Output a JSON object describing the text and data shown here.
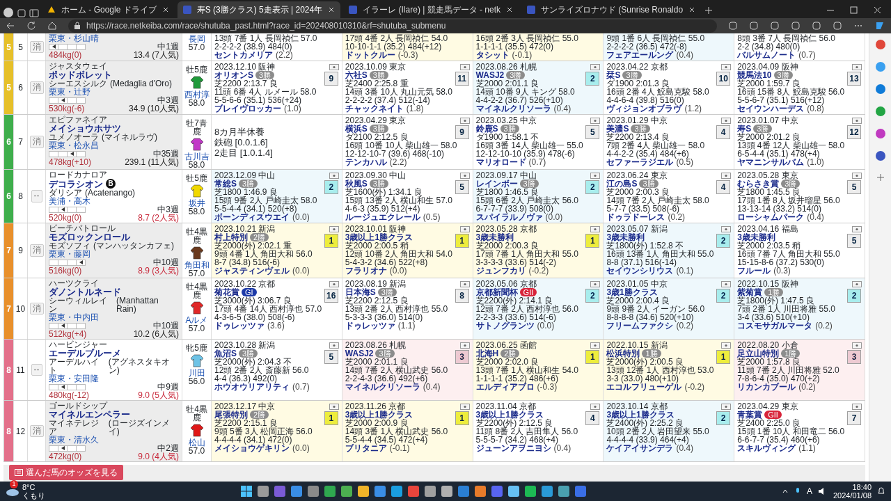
{
  "browser": {
    "tabs": [
      {
        "title": "ホーム - Google ドライブ",
        "selected": false
      },
      {
        "title": "寿S (3勝クラス) 5走表示 | 2024年",
        "selected": true
      },
      {
        "title": "イラーレ (Ilare) | 競走馬データ - netk",
        "selected": false
      },
      {
        "title": "サンライズロナウド (Sunrise Ronaldo",
        "selected": false
      }
    ],
    "url": "https://race.netkeiba.com/race/shutuba_past.html?race_id=202408010310&rf=shutuba_submenu"
  },
  "race_table": {
    "rows": [
      {
        "frame": "5",
        "color": "#e6c02a",
        "number": "5",
        "eliminated": true,
        "scratch_label": "消",
        "horse": {
          "trainer": "栗東・杉山晴",
          "marks": [
            {
              "selected": true
            },
            {
              "selected": false
            },
            {
              "selected": false
            },
            {
              "selected": false
            }
          ],
          "rotation": "中1週",
          "weight": "484kg(0)",
          "odds": "13.4 (7人気)",
          "odds_hot": false
        },
        "jockey": {
          "name": "長岡",
          "weight": "57.0"
        },
        "races": [
          {
            "kind": "race",
            "color": "#ffffff",
            "field": "13頭 7番 1人 長岡禎仁 57.0",
            "passing": "2-2-2-2 (38.9) 484(0)",
            "winner": "セントカメリア",
            "margin": "(2.2)"
          },
          {
            "kind": "race",
            "color": "#fffbe3",
            "field": "17頭 4番 2人 長岡禎仁 54.0",
            "passing": "10-10-1-1 (35.2) 484(+12)",
            "winner": "ドットクルー",
            "margin": "(-0.3)"
          },
          {
            "kind": "race",
            "color": "#fffbe3",
            "field": "16頭 2番 3人 長岡禎仁 55.0",
            "passing": "1-1-1-1 (35.5) 472(0)",
            "winner": "タシット",
            "margin": "(-0.1)"
          },
          {
            "kind": "race",
            "color": "#eef8fc",
            "field": "9頭 1番 6人 長岡禎仁 55.0",
            "passing": "2-2-2-2 (36.5) 472(-8)",
            "winner": "フェアエールング",
            "margin": "(0.4)"
          },
          {
            "kind": "race",
            "color": "#ffffff",
            "field": "8頭 3番 7人 長岡禎仁 56.0",
            "passing": "2-2 (34.8) 480(0)",
            "winner": "バルサムノート",
            "margin": "(0.7)"
          }
        ]
      },
      {
        "frame": "5",
        "color": "#e6c02a",
        "number": "6",
        "eliminated": true,
        "scratch_label": "消",
        "horse": {
          "sire": "ジャスタウェイ",
          "name": "ポッドボレット",
          "sex_age": "牡5鹿",
          "dam": "シーエスシルク",
          "damsire": "(Medaglia d'Oro)",
          "trainer": "栗東・辻野",
          "marks": [
            {
              "selected": false
            },
            {
              "selected": true
            },
            {
              "selected": false
            },
            {
              "selected": false
            }
          ],
          "rotation": "中3週",
          "weight": "530kg(-6)",
          "odds": "34.9 (10人気)",
          "odds_hot": false
        },
        "jockey": {
          "color": "#1f9a3a",
          "name": "西村淳",
          "weight": "58.0"
        },
        "races": [
          {
            "kind": "race",
            "color": "#ffffff",
            "date": "2023.12.10 阪神",
            "name": "オリオンS",
            "badge": {
              "text": "3勝",
              "color": "#8c8c8c"
            },
            "finish": "9",
            "course": "芝2200 2:13.7 良",
            "field": "11頭 6番 4人 ルメール 58.0",
            "passing": "5-5-6-6 (35.1) 536(+24)",
            "winner": "ブレイヴロッカー",
            "margin": "(1.0)"
          },
          {
            "kind": "race",
            "color": "#ffffff",
            "date": "2023.10.09 東京",
            "name": "六社S",
            "badge": {
              "text": "3勝",
              "color": "#8c8c8c"
            },
            "finish": "11",
            "course": "芝2400 2:25.8 重",
            "field": "14頭 3番 10人 丸山元気 58.0",
            "passing": "2-2-2-2 (37.4) 512(-14)",
            "winner": "チャックネイト",
            "margin": "(1.8)"
          },
          {
            "kind": "race",
            "color": "#eef8fc",
            "date": "2023.08.26 札幌",
            "name": "WASJ2",
            "badge": {
              "text": "3勝",
              "color": "#8c8c8c"
            },
            "finish": "2",
            "course": "芝2000 2:01.1 良",
            "field": "14頭 10番 9人 キング 58.0",
            "passing": "4-4-2-2 (36.7) 526(+10)",
            "winner": "マイネルクリソーラ",
            "margin": "(0.4)"
          },
          {
            "kind": "race",
            "color": "#ffffff",
            "date": "2023.04.22 京都",
            "name": "栞S",
            "badge": {
              "text": "3勝",
              "color": "#8c8c8c"
            },
            "finish": "10",
            "course": "ダ1900 2:01.3 良",
            "field": "16頭 2番 4人 鮫島克駿 58.0",
            "passing": "4-4-6-4 (39.8) 516(0)",
            "winner": "ヴィジョンオブラヴ",
            "margin": "(1.2)"
          },
          {
            "kind": "race",
            "color": "#ffffff",
            "date": "2023.04.09 阪神",
            "name": "競馬法10",
            "badge": {
              "text": "3勝",
              "color": "#8c8c8c"
            },
            "finish": "13",
            "course": "芝2000 1:59.7 良",
            "field": "16頭 15番 8人 鮫島克駿 56.0",
            "passing": "5-5-6-7 (35.1) 516(+12)",
            "winner": "セイウンハーデス",
            "margin": "(0.8)"
          }
        ]
      },
      {
        "frame": "6",
        "color": "#3fae4c",
        "number": "7",
        "eliminated": true,
        "scratch_label": "消",
        "horse": {
          "sire": "エピファネイア",
          "name": "メイショウホサツ",
          "sex_age": "牡7青鹿",
          "dam": "ユメノオーラ",
          "damsire": "(マイネルラヴ)",
          "trainer": "栗東・松永昌",
          "marks": [
            {
              "selected": false
            },
            {
              "selected": false
            },
            {
              "selected": true
            },
            {
              "selected": false
            }
          ],
          "rotation": "中35週",
          "weight": "478kg(+10)",
          "odds": "239.1 (11人気)",
          "odds_hot": false
        },
        "jockey": {
          "color": "#c238c8",
          "name": "古川吉",
          "weight": "58.0"
        },
        "races": [
          {
            "kind": "layoff",
            "lines": [
              "8カ月半休養",
              "鉄砲 [0.0.1.6]",
              "2走目 [1.0.1.4]"
            ]
          },
          {
            "kind": "race",
            "color": "#ffffff",
            "date": "2023.04.29 東京",
            "name": "横浜S",
            "badge": {
              "text": "3勝",
              "color": "#8c8c8c"
            },
            "finish": "9",
            "course": "ダ2100 2:12.5 良",
            "field": "16頭 10番 10人 柴山雄一 58.0",
            "passing": "12-12-10-7 (39.6) 468(-10)",
            "winner": "テンカハル",
            "margin": "(2.2)"
          },
          {
            "kind": "race",
            "color": "#ffffff",
            "date": "2023.03.25 中京",
            "name": "鈴鹿S",
            "badge": {
              "text": "3勝",
              "color": "#8c8c8c"
            },
            "finish": "5",
            "course": "ダ1900 1:58.1 不",
            "field": "16頭 3番 14人 柴山雄一 55.0",
            "passing": "12-12-10-10 (35.9) 478(-6)",
            "winner": "マリオロード",
            "margin": "(0.7)"
          },
          {
            "kind": "race",
            "color": "#ffffff",
            "date": "2023.01.29 中京",
            "name": "美濃S",
            "badge": {
              "text": "3勝",
              "color": "#8c8c8c"
            },
            "finish": "4",
            "course": "芝2200 2:13.4 良",
            "field": "7頭 2番 4人 柴山雄一 58.0",
            "passing": "4-4-2-2 (35.4) 484(+6)",
            "winner": "セファーラジエル",
            "margin": "(0.5)"
          },
          {
            "kind": "race",
            "color": "#ffffff",
            "date": "2023.01.07 中京",
            "name": "寿S",
            "badge": {
              "text": "3勝",
              "color": "#8c8c8c"
            },
            "finish": "12",
            "course": "芝2000 2:01.2 良",
            "field": "13頭 4番 12人 柴山雄一 58.0",
            "passing": "6-5-4-4 (35.1) 478(+4)",
            "winner": "ヤマニンサルバム",
            "margin": "(1.0)"
          }
        ]
      },
      {
        "frame": "6",
        "color": "#3fae4c",
        "number": "8",
        "eliminated": false,
        "scratch_label": "--",
        "horse": {
          "sire": "ロードカナロア",
          "name": "デコラシオン",
          "blinker": "B",
          "sex_age": "牡5鹿",
          "dam": "ダリシア",
          "damsire": "(Acatenango)",
          "trainer": "美浦・高木",
          "marks": [
            {
              "selected": false
            },
            {
              "selected": true
            },
            {
              "selected": false
            },
            {
              "selected": false
            }
          ],
          "rotation": "中3週",
          "weight": "520kg(0)",
          "odds": "8.7 (2人気)",
          "odds_hot": true
        },
        "jockey": {
          "color": "#f0d800",
          "name": "坂井",
          "weight": "58.0"
        },
        "races": [
          {
            "kind": "race",
            "color": "#eef8fc",
            "date": "2023.12.09 中山",
            "name": "常総S",
            "badge": {
              "text": "3勝",
              "color": "#8c8c8c"
            },
            "finish": "2",
            "course": "芝1800 1:46.9 良",
            "field": "15頭 9番 2人 戸崎圭太 58.0",
            "passing": "5-5-4-4 (34.1) 520(+8)",
            "winner": "ボーンディスウエイ",
            "margin": "(0.0)"
          },
          {
            "kind": "race",
            "color": "#ffffff",
            "date": "2023.09.30 中山",
            "name": "秋風S",
            "badge": {
              "text": "3勝",
              "color": "#8c8c8c"
            },
            "finish": "5",
            "course": "芝1600(外) 1:34.1 良",
            "field": "15頭 13番 2人 横山和生 57.0",
            "passing": "4-6-3 (35.9) 512(+4)",
            "winner": "ルージュエクレール",
            "margin": "(0.5)"
          },
          {
            "kind": "race",
            "color": "#eef8fc",
            "date": "2023.09.17 中山",
            "name": "レインボー",
            "badge": {
              "text": "3勝",
              "color": "#8c8c8c"
            },
            "finish": "2",
            "course": "芝1800 1:46.5 良",
            "field": "15頭 6番 2人 戸崎圭太 56.0",
            "passing": "6-7-7-7 (33.9) 508(0)",
            "winner": "スパイラルノヴァ",
            "margin": "(0.0)"
          },
          {
            "kind": "race",
            "color": "#ffffff",
            "date": "2023.06.24 東京",
            "name": "江の島S",
            "badge": {
              "text": "3勝",
              "color": "#8c8c8c"
            },
            "finish": "4",
            "course": "芝2000 2:00.3 良",
            "field": "14頭 7番 2人 戸崎圭太 58.0",
            "passing": "5-7-7 (33.5) 508(-6)",
            "winner": "ドゥラドーレス",
            "margin": "(0.2)"
          },
          {
            "kind": "race",
            "color": "#ffffff",
            "date": "2023.05.28 東京",
            "name": "むらさき賞",
            "badge": {
              "text": "3勝",
              "color": "#8c8c8c"
            },
            "finish": "5",
            "course": "芝1800 1:45.5 良",
            "field": "17頭 1番 8人 坂井瑠星 56.0",
            "passing": "13-13-14 (33.2) 514(0)",
            "winner": "ローシャムパーク",
            "margin": "(0.4)"
          }
        ]
      },
      {
        "frame": "7",
        "color": "#e8902c",
        "number": "9",
        "eliminated": true,
        "scratch_label": "消",
        "horse": {
          "sire": "ビーチパトロール",
          "name": "モズロックンロール",
          "sex_age": "牡4黒鹿",
          "dam": "モズソフィ",
          "damsire": "(マンハッタンカフェ)",
          "trainer": "栗東・藤岡",
          "marks": [
            {
              "selected": false
            },
            {
              "selected": false
            },
            {
              "selected": false
            },
            {
              "selected": true
            }
          ],
          "rotation": "中10週",
          "weight": "516kg(0)",
          "odds": "8.9 (3人気)",
          "odds_hot": true
        },
        "jockey": {
          "color": "#6b3a1e",
          "name": "角田和",
          "weight": "57.0"
        },
        "races": [
          {
            "kind": "race",
            "color": "#fffbe3",
            "date": "2023.10.21 新潟",
            "name": "村上特別",
            "badge": {
              "text": "2勝",
              "color": "#8c8c8c"
            },
            "finish": "1",
            "course": "芝2000(外) 2:02.1 重",
            "field": "9頭 4番 1人 角田大和 56.0",
            "passing": "8-7 (34.8) 516(-6)",
            "winner": "ジャスティンヴェル",
            "margin": "(0.0)"
          },
          {
            "kind": "race",
            "color": "#fffbe3",
            "date": "2023.10.01 阪神",
            "name": "3歳以上1勝クラス",
            "finish": "1",
            "course": "芝2000 2:00.5 稍",
            "field": "12頭 10番 2人 角田大和 54.0",
            "passing": "5-4-3-2 (34.6) 522(+8)",
            "winner": "フラリオナ",
            "margin": "(0.0)"
          },
          {
            "kind": "race",
            "color": "#fffbe3",
            "date": "2023.05.28 京都",
            "name": "3歳未勝利",
            "finish": "1",
            "course": "芝2000 2:00.3 良",
            "field": "17頭 7番 1人 角田大和 55.0",
            "passing": "3-3-3-3 (33.6) 514(-2)",
            "winner": "ジュンフカリ",
            "margin": "(-0.2)"
          },
          {
            "kind": "race",
            "color": "#eef8fc",
            "date": "2023.05.07 新潟",
            "name": "3歳未勝利",
            "finish": "2",
            "course": "芝1800(外) 1:52.8 不",
            "field": "16頭 13番 1人 角田大和 55.0",
            "passing": "8-8 (37.1) 516(-14)",
            "winner": "セイウンシリウス",
            "margin": "(0.1)"
          },
          {
            "kind": "race",
            "color": "#ffffff",
            "date": "2023.04.16 福島",
            "name": "3歳未勝利",
            "finish": "5",
            "course": "芝2000 2:03.5 稍",
            "field": "16頭 7番 7人 角田大和 55.0",
            "passing": "15-15-8-6 (37.2) 530(0)",
            "winner": "フルール",
            "margin": "(0.3)"
          }
        ]
      },
      {
        "frame": "7",
        "color": "#e8902c",
        "number": "10",
        "eliminated": true,
        "scratch_label": "消",
        "horse": {
          "sire": "ハーツクライ",
          "name": "ダノントルネード",
          "sex_age": "牡4黒鹿",
          "dam": "シーウィルレイン",
          "damsire": "(Manhattan Rain)",
          "trainer": "栗東・中内田",
          "marks": [
            {
              "selected": false
            },
            {
              "selected": true
            },
            {
              "selected": false
            },
            {
              "selected": false
            }
          ],
          "rotation": "中10週",
          "weight": "512kg(+4)",
          "odds": "10.2 (6人気)",
          "odds_hot": false
        },
        "jockey": {
          "color": "#e02828",
          "name": "Aルメ",
          "weight": "57.0"
        },
        "races": [
          {
            "kind": "race",
            "color": "#ffffff",
            "date": "2023.10.22 京都",
            "name": "菊花賞",
            "badge": {
              "text": "GI",
              "color": "#1d3aa8"
            },
            "finish": "16",
            "course": "芝3000(外) 3:06.7 良",
            "field": "17頭 4番 14人 西村淳也 57.0",
            "passing": "4-3-6-5 (38.0) 508(-6)",
            "winner": "ドゥレッツァ",
            "margin": "(3.6)"
          },
          {
            "kind": "race",
            "color": "#ffffff",
            "date": "2023.08.19 新潟",
            "name": "日本海S",
            "badge": {
              "text": "3勝",
              "color": "#8c8c8c"
            },
            "finish": "8",
            "course": "芝2200 2:12.5 良",
            "field": "13頭 2番 2人 西村淳也 55.0",
            "passing": "5-3-3-3 (36.0) 514(0)",
            "winner": "ドゥレッツァ",
            "margin": "(1.1)"
          },
          {
            "kind": "race",
            "color": "#eef8fc",
            "date": "2023.05.06 京都",
            "name": "京都新聞杯",
            "badge": {
              "text": "GII",
              "color": "#d8243a"
            },
            "finish": "2",
            "course": "芝2200(外) 2:14.1 良",
            "field": "12頭 7番 2人 西村淳也 56.0",
            "passing": "2-2-3-3 (33.6) 514(-6)",
            "winner": "サトノグランツ",
            "margin": "(0.0)"
          },
          {
            "kind": "race",
            "color": "#eef8fc",
            "date": "2023.01.05 中京",
            "name": "3歳1勝クラス",
            "finish": "2",
            "course": "芝2000 2:00.4 良",
            "field": "9頭 9番 2人 イーガン 56.0",
            "passing": "8-8-8-8 (34.6) 520(+10)",
            "winner": "フリームファクシ",
            "margin": "(0.2)"
          },
          {
            "kind": "race",
            "color": "#eef8fc",
            "date": "2022.10.15 阪神",
            "name": "紫菊賞",
            "badge": {
              "text": "1勝",
              "color": "#8c8c8c"
            },
            "finish": "2",
            "course": "芝1800(外) 1:47.5 良",
            "field": "7頭 2番 1人 川田将雅 55.0",
            "passing": "3-4 (33.6) 510(+10)",
            "winner": "コスモサガルマータ",
            "margin": "(0.2)"
          }
        ]
      },
      {
        "frame": "8",
        "color": "#e3708a",
        "number": "11",
        "eliminated": false,
        "scratch_label": "--",
        "horse": {
          "sire": "ハービンジャー",
          "name": "エーデルブルーメ",
          "sex_age": "牝5鹿",
          "dam": "アーデルハイト",
          "damsire": "(アグネスタキオン)",
          "trainer": "栗東・安田隆",
          "marks": [
            {
              "selected": false
            },
            {
              "selected": true
            },
            {
              "selected": false
            },
            {
              "selected": false
            }
          ],
          "rotation": "中9週",
          "weight": "480kg(-12)",
          "odds": "9.0 (5人気)",
          "odds_hot": true
        },
        "jockey": {
          "color": "#6ec3e6",
          "name": "川田",
          "weight": "56.0"
        },
        "races": [
          {
            "kind": "race",
            "color": "#ffffff",
            "date": "2023.10.28 新潟",
            "name": "魚沼S",
            "badge": {
              "text": "3勝",
              "color": "#8c8c8c"
            },
            "finish": "5",
            "course": "芝2000(外) 2:04.3 不",
            "field": "12頭 2番 2人 斎藤新 56.0",
            "passing": "4-4 (36.3) 492(0)",
            "winner": "ホウオウリアリティ",
            "margin": "(0.7)"
          },
          {
            "kind": "race",
            "color": "#fdeff0",
            "date": "2023.08.26 札幌",
            "name": "WASJ2",
            "badge": {
              "text": "3勝",
              "color": "#8c8c8c"
            },
            "finish": "3",
            "course": "芝2000 2:01.1 良",
            "field": "14頭 7番 2人 横山武史 56.0",
            "passing": "2-2-4-3 (36.6) 492(+6)",
            "winner": "マイネルクリソーラ",
            "margin": "(0.4)"
          },
          {
            "kind": "race",
            "color": "#fffbe3",
            "date": "2023.06.25 函館",
            "name": "北海H",
            "badge": {
              "text": "2勝",
              "color": "#8c8c8c"
            },
            "finish": "1",
            "course": "芝2000 2:02.0 良",
            "field": "13頭 7番 1人 横山和生 54.0",
            "passing": "1-1-1-1 (35.2) 486(+6)",
            "winner": "エルディアブロ",
            "margin": "(-0.3)"
          },
          {
            "kind": "race",
            "color": "#fffbe3",
            "date": "2022.10.15 新潟",
            "name": "松浜特別",
            "badge": {
              "text": "1勝",
              "color": "#8c8c8c"
            },
            "finish": "1",
            "course": "芝2000(外) 2:00.5 良",
            "field": "13頭 12番 1人 西村淳也 53.0",
            "passing": "3-3 (33.0) 480(+10)",
            "winner": "エコルフリューゲル",
            "margin": "(-0.2)"
          },
          {
            "kind": "race",
            "color": "#fdeff0",
            "date": "2022.08.20 小倉",
            "name": "足立山特別",
            "badge": {
              "text": "1勝",
              "color": "#8c8c8c"
            },
            "finish": "3",
            "course": "芝2000 1:57.8 良",
            "field": "11頭 7番 2人 川田将雅 52.0",
            "passing": "7-8-6-4 (35.0) 470(+2)",
            "winner": "リカンカブール",
            "margin": "(0.2)"
          }
        ]
      },
      {
        "frame": "8",
        "color": "#e3708a",
        "number": "12",
        "eliminated": true,
        "scratch_label": "消",
        "horse": {
          "sire": "ゴールドシップ",
          "name": "マイネルエンペラー",
          "sex_age": "牡4黒鹿",
          "dam": "マイネテレジア",
          "damsire": "(ロージズインメイ)",
          "trainer": "栗東・清水久",
          "marks": [
            {
              "selected": false
            },
            {
              "selected": true
            },
            {
              "selected": false
            },
            {
              "selected": false
            }
          ],
          "rotation": "中2週",
          "weight": "472kg(0)",
          "odds": "9.0 (4人気)",
          "odds_hot": true
        },
        "jockey": {
          "color": "#e01818",
          "name": "松山",
          "weight": "57.0"
        },
        "races": [
          {
            "kind": "race",
            "color": "#fffbe3",
            "date": "2023.12.17 中京",
            "name": "尾張特別",
            "badge": {
              "text": "2勝",
              "color": "#8c8c8c"
            },
            "finish": "1",
            "course": "芝2200 2:15.1 良",
            "field": "9頭 5番 3人 松岡正海 56.0",
            "passing": "4-4-4-4 (34.1) 472(0)",
            "winner": "メイショウゲキリン",
            "margin": "(0.0)"
          },
          {
            "kind": "race",
            "color": "#fffbe3",
            "date": "2023.11.26 京都",
            "name": "3歳以上1勝クラス",
            "finish": "1",
            "course": "芝2000 2:00.9 良",
            "field": "14頭 3番 1人 横山武史 56.0",
            "passing": "5-5-4-4 (34.5) 472(+4)",
            "winner": "ブリタニア",
            "margin": "(-0.1)"
          },
          {
            "kind": "race",
            "color": "#ffffff",
            "date": "2023.11.04 京都",
            "name": "3歳以上1勝クラス",
            "finish": "4",
            "course": "芝2200(外) 2:12.5 良",
            "field": "11頭 8番 2人 吉田隼人 56.0",
            "passing": "5-5-5-7 (34.2) 468(+4)",
            "winner": "ジューンアヲニヨシ",
            "margin": "(0.4)"
          },
          {
            "kind": "race",
            "color": "#eef8fc",
            "date": "2023.10.14 京都",
            "name": "3歳以上1勝クラス",
            "finish": "2",
            "course": "芝2400(外) 2:25.2 良",
            "field": "10頭 2番 2人 岩田望来 55.0",
            "passing": "4-4-4-4 (33.9) 464(+4)",
            "winner": "ケイアイサンデラ",
            "margin": "(0.4)"
          },
          {
            "kind": "race",
            "color": "#ffffff",
            "date": "2023.04.29 東京",
            "name": "青葉賞",
            "badge": {
              "text": "GII",
              "color": "#d8243a"
            },
            "finish": "7",
            "course": "芝2400 2:25.0 良",
            "field": "15頭 1番 10人 和田竜二 56.0",
            "passing": "6-6-7-7 (35.4) 460(+6)",
            "winner": "スキルヴィング",
            "margin": "(1.1)"
          }
        ]
      }
    ]
  },
  "odds_button": "選んだ馬のオッズを見る",
  "taskbar": {
    "weather_badge": "1",
    "temperature": "8°C",
    "weather": "くもり",
    "ime": "A",
    "time": "18:40",
    "date": "2024/01/08"
  }
}
